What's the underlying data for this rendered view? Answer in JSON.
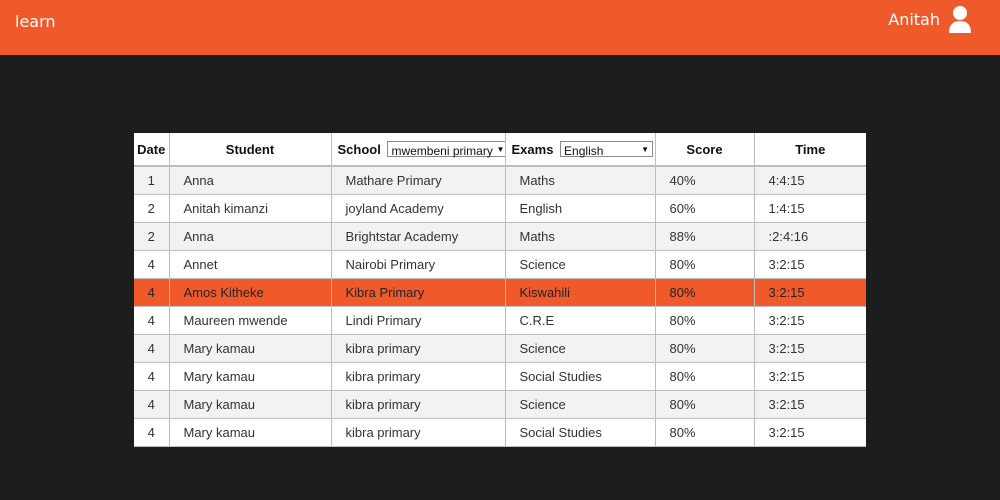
{
  "app": {
    "brand": "learn",
    "user_name": "Anitah"
  },
  "table": {
    "headers": {
      "date": "Date",
      "student": "Student",
      "school": "School",
      "exams": "Exams",
      "score": "Score",
      "time": "Time"
    },
    "school_filter": {
      "selected": "mwembeni primary"
    },
    "exams_filter": {
      "selected": "English"
    },
    "rows": [
      {
        "date": "1",
        "student": "Anna",
        "school": "Mathare Primary",
        "exam": "Maths",
        "score": "40%",
        "time": "4:4:15"
      },
      {
        "date": "2",
        "student": "Anitah kimanzi",
        "school": "joyland Academy",
        "exam": "English",
        "score": "60%",
        "time": "1:4:15"
      },
      {
        "date": "2",
        "student": "Anna",
        "school": "Brightstar Academy",
        "exam": "Maths",
        "score": "88%",
        "time": ":2:4:16"
      },
      {
        "date": "4",
        "student": "Annet",
        "school": "Nairobi Primary",
        "exam": "Science",
        "score": "80%",
        "time": "3:2:15"
      },
      {
        "date": "4",
        "student": "Amos Kitheke",
        "school": "Kibra Primary",
        "exam": "Kiswahili",
        "score": "80%",
        "time": "3:2:15"
      },
      {
        "date": "4",
        "student": "Maureen mwende",
        "school": "Lindi Primary",
        "exam": "C.R.E",
        "score": "80%",
        "time": "3:2:15"
      },
      {
        "date": "4",
        "student": "Mary kamau",
        "school": "kibra primary",
        "exam": "Science",
        "score": "80%",
        "time": "3:2:15"
      },
      {
        "date": "4",
        "student": "Mary kamau",
        "school": "kibra primary",
        "exam": "Social Studies",
        "score": "80%",
        "time": "3:2:15"
      },
      {
        "date": "4",
        "student": "Mary kamau",
        "school": "kibra primary",
        "exam": "Science",
        "score": "80%",
        "time": "3:2:15"
      },
      {
        "date": "4",
        "student": "Mary kamau",
        "school": "kibra primary",
        "exam": "Social Studies",
        "score": "80%",
        "time": "3:2:15"
      }
    ],
    "selected_row_index": 4
  },
  "colors": {
    "accent": "#f05a2b",
    "background": "#1d1d1d"
  }
}
